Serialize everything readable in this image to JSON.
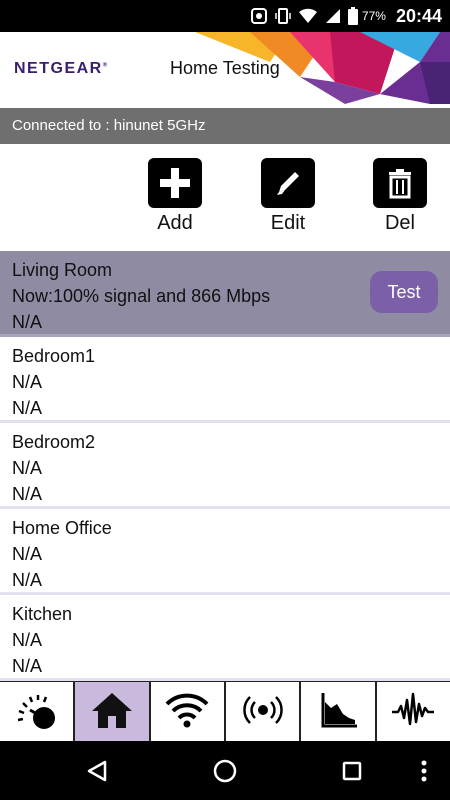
{
  "status_bar": {
    "battery_percent": "77%",
    "time": "20:44",
    "icons": [
      "notification-icon",
      "vibrate-icon",
      "wifi-icon",
      "cell-signal-icon",
      "battery-icon"
    ]
  },
  "header": {
    "brand": "NETGEAR",
    "brand_mark": "®",
    "title": "Home Testing"
  },
  "connection": {
    "text": "Connected to : hinunet 5GHz"
  },
  "toolbar": {
    "add_label": "Add",
    "edit_label": "Edit",
    "del_label": "Del"
  },
  "locations": [
    {
      "name": "Living Room",
      "now": "Now:100% signal and 866 Mbps",
      "detail": "N/A",
      "selected": true
    },
    {
      "name": "Bedroom1",
      "now": "N/A",
      "detail": "N/A"
    },
    {
      "name": "Bedroom2",
      "now": "N/A",
      "detail": "N/A"
    },
    {
      "name": "Home Office",
      "now": "N/A",
      "detail": "N/A"
    },
    {
      "name": "Kitchen",
      "now": "N/A",
      "detail": "N/A"
    }
  ],
  "test_button_label": "Test",
  "bottom_tabs": [
    {
      "icon": "speedometer-icon",
      "active": false
    },
    {
      "icon": "home-icon",
      "active": true
    },
    {
      "icon": "wifi-icon",
      "active": false
    },
    {
      "icon": "signal-broadcast-icon",
      "active": false
    },
    {
      "icon": "area-chart-icon",
      "active": false
    },
    {
      "icon": "waveform-icon",
      "active": false
    }
  ],
  "nav_bar": [
    "back-icon",
    "home-circle-icon",
    "recents-icon",
    "overflow-menu-icon"
  ],
  "colors": {
    "brand_purple": "#3b1e6e",
    "selected_row": "#8f8ba3",
    "test_button": "#7b60a8",
    "active_tab": "#c9b9dc",
    "connection_bar": "#6f6f6f"
  }
}
